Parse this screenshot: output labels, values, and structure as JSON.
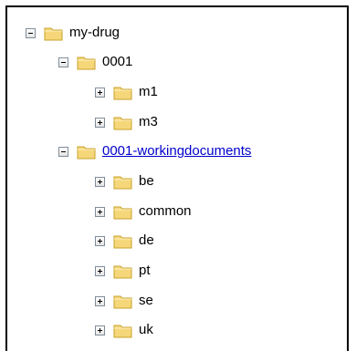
{
  "tree": {
    "nodes": [
      {
        "label": "my-drug",
        "state": "expanded",
        "link": false
      },
      {
        "label": "0001",
        "state": "expanded",
        "link": false
      },
      {
        "label": "m1",
        "state": "collapsed",
        "link": false
      },
      {
        "label": "m3",
        "state": "collapsed",
        "link": false
      },
      {
        "label": "0001-workingdocuments",
        "state": "expanded",
        "link": true
      },
      {
        "label": "be",
        "state": "collapsed",
        "link": false
      },
      {
        "label": "common",
        "state": "collapsed",
        "link": false
      },
      {
        "label": "de",
        "state": "collapsed",
        "link": false
      },
      {
        "label": "pt",
        "state": "collapsed",
        "link": false
      },
      {
        "label": "se",
        "state": "collapsed",
        "link": false
      },
      {
        "label": "uk",
        "state": "collapsed",
        "link": false
      }
    ]
  },
  "icons": {
    "folder": "folder-icon",
    "expand": "plus-box-icon",
    "collapse": "minus-box-icon"
  },
  "colors": {
    "folder_fill": "#f5d77a",
    "folder_edge": "#c9a02a",
    "link": "#0000cc"
  }
}
